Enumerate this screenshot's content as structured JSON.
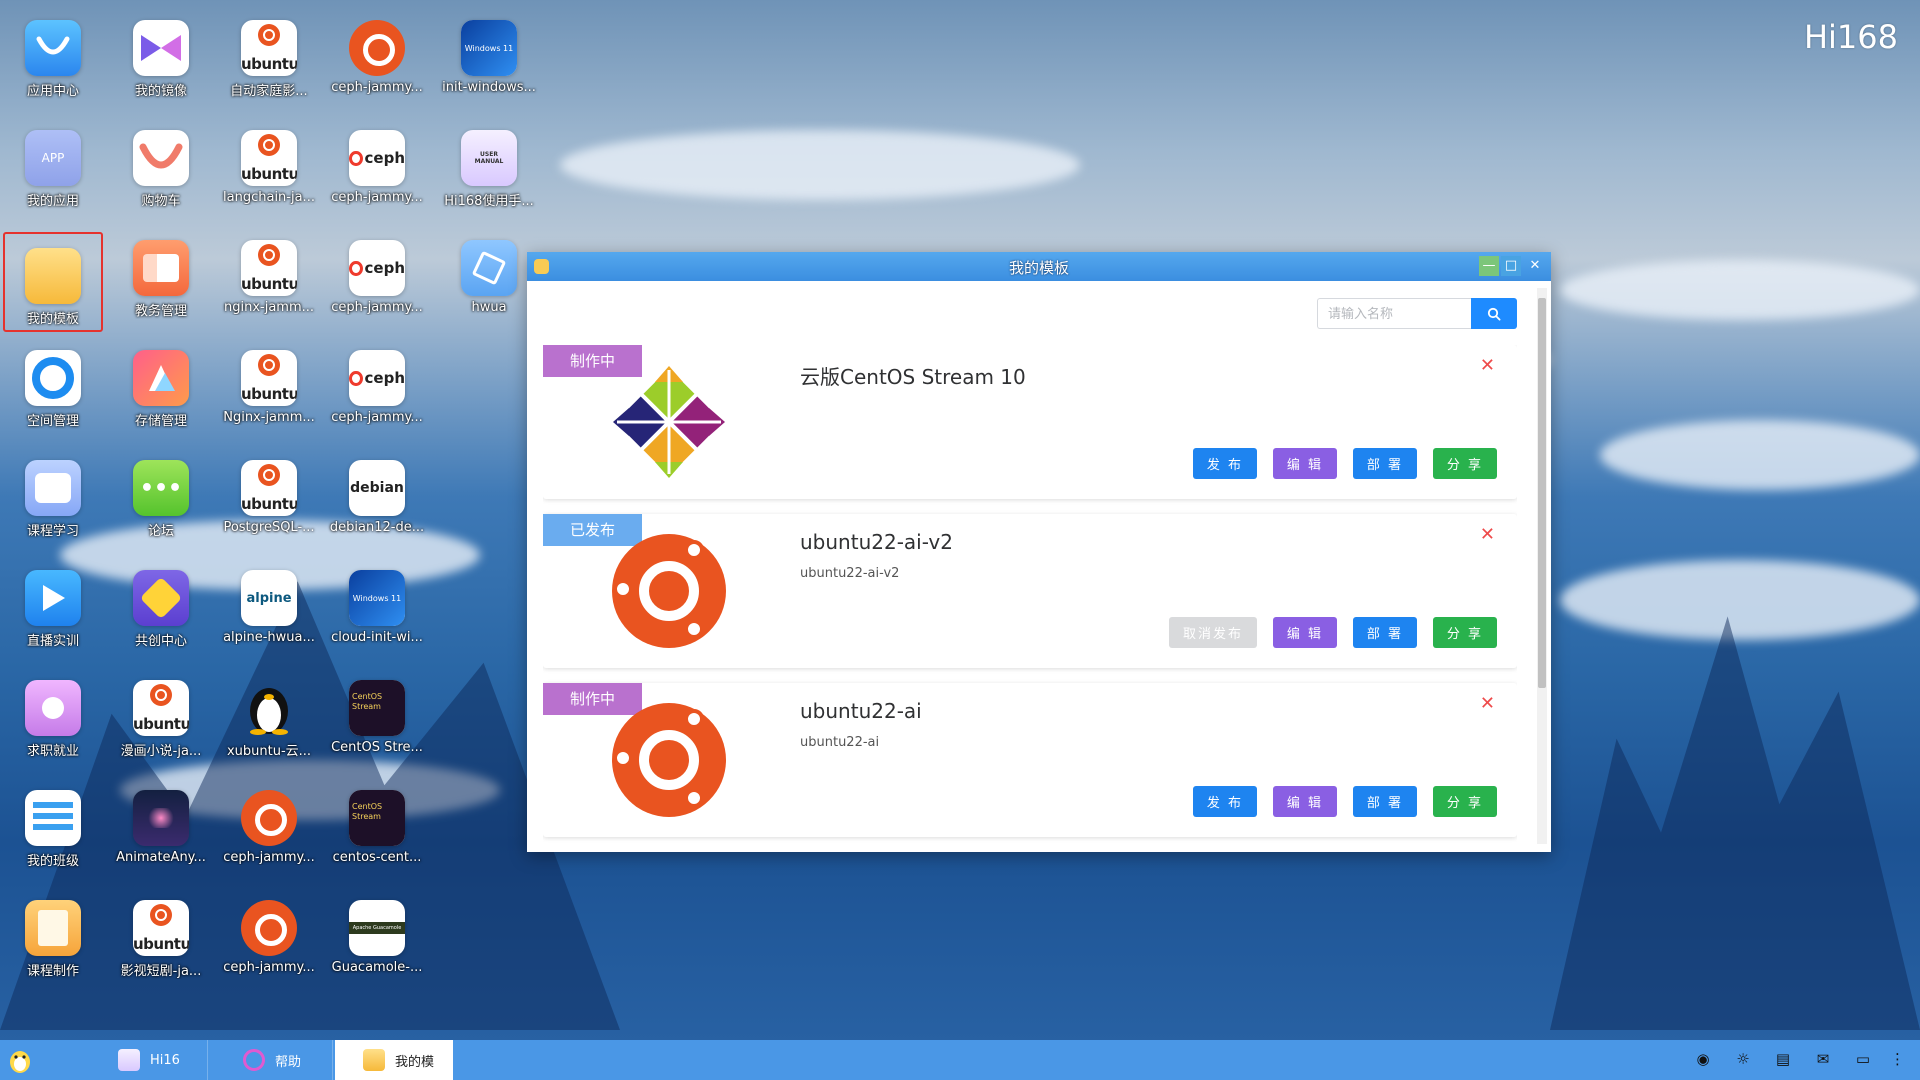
{
  "brand": {
    "logo_text": "Hi168"
  },
  "desktop_icons": [
    {
      "label": "应用中心",
      "icon": "app-center-icon"
    },
    {
      "label": "我的应用",
      "icon": "my-apps-icon",
      "badge": "APP"
    },
    {
      "label": "我的模板",
      "icon": "my-templates-icon"
    },
    {
      "label": "空间管理",
      "icon": "space-management-icon"
    },
    {
      "label": "课程学习",
      "icon": "course-learning-icon"
    },
    {
      "label": "直播实训",
      "icon": "live-training-icon"
    },
    {
      "label": "求职就业",
      "icon": "job-icon"
    },
    {
      "label": "我的班级",
      "icon": "my-class-icon"
    },
    {
      "label": "课程制作",
      "icon": "course-making-icon"
    },
    {
      "label": "我的镜像",
      "icon": "my-images-icon"
    },
    {
      "label": "购物车",
      "icon": "shopping-cart-icon"
    },
    {
      "label": "教务管理",
      "icon": "academic-management-icon"
    },
    {
      "label": "存储管理",
      "icon": "storage-management-icon"
    },
    {
      "label": "论坛",
      "icon": "forum-icon"
    },
    {
      "label": "共创中心",
      "icon": "co-creation-icon"
    },
    {
      "label": "漫画小说-ja...",
      "icon": "ubuntu-icon",
      "word": "ubuntu"
    },
    {
      "label": "AnimateAny...",
      "icon": "animate-icon"
    },
    {
      "label": "影视短剧-ja...",
      "icon": "ubuntu-icon",
      "word": "ubuntu"
    },
    {
      "label": "自动家庭影...",
      "icon": "ubuntu-icon",
      "word": "ubuntu"
    },
    {
      "label": "langchain-ja...",
      "icon": "ubuntu-icon",
      "word": "ubuntu"
    },
    {
      "label": "nginx-jamm...",
      "icon": "ubuntu-icon",
      "word": "ubuntu"
    },
    {
      "label": "Nginx-jamm...",
      "icon": "ubuntu-icon",
      "word": "ubuntu"
    },
    {
      "label": "PostgreSQL-...",
      "icon": "ubuntu-icon",
      "word": "ubuntu"
    },
    {
      "label": "alpine-hwua...",
      "icon": "alpine-icon",
      "word": "alpine"
    },
    {
      "label": "xubuntu-云...",
      "icon": "penguin-icon"
    },
    {
      "label": "ceph-jammy...",
      "icon": "ubuntu-circle-icon"
    },
    {
      "label": "ceph-jammy...",
      "icon": "ubuntu-circle-icon"
    },
    {
      "label": "ceph-jammy...",
      "icon": "ubuntu-circle-icon"
    },
    {
      "label": "ceph-jammy...",
      "icon": "ceph-icon",
      "word": "ceph"
    },
    {
      "label": "ceph-jammy...",
      "icon": "ceph-icon",
      "word": "ceph"
    },
    {
      "label": "ceph-jammy...",
      "icon": "ceph-icon",
      "word": "ceph"
    },
    {
      "label": "debian12-de...",
      "icon": "debian-icon",
      "word": "debian"
    },
    {
      "label": "cloud-init-wi...",
      "icon": "windows-icon",
      "word": "Windows 11"
    },
    {
      "label": "CentOS Stre...",
      "icon": "centos-stream-icon",
      "word": "CentOS Stream"
    },
    {
      "label": "centos-cent...",
      "icon": "centos-stream-icon",
      "word": "CentOS Stream"
    },
    {
      "label": "Guacamole-...",
      "icon": "guacamole-icon",
      "word": "Apache Guacamole"
    },
    {
      "label": "init-windows...",
      "icon": "windows-icon",
      "word": "Windows 11"
    },
    {
      "label": "Hi168使用手...",
      "icon": "user-manual-icon",
      "word": "USER MANUAL"
    },
    {
      "label": "hwua",
      "icon": "hwua-icon"
    }
  ],
  "window": {
    "title": "我的模板",
    "search_placeholder": "请输入名称",
    "templates": [
      {
        "status": "制作中",
        "title": "云版CentOS Stream 10",
        "desc": "",
        "logo": "centos",
        "actions": [
          "发 布",
          "编 辑",
          "部 署",
          "分 享"
        ]
      },
      {
        "status": "已发布",
        "title": "ubuntu22-ai-v2",
        "desc": "ubuntu22-ai-v2",
        "logo": "ubuntu",
        "actions": [
          "取消发布",
          "编 辑",
          "部 署",
          "分 享"
        ]
      },
      {
        "status": "制作中",
        "title": "ubuntu22-ai",
        "desc": "ubuntu22-ai",
        "logo": "ubuntu",
        "actions": [
          "发 布",
          "编 辑",
          "部 署",
          "分 享"
        ]
      }
    ]
  },
  "taskbar": {
    "items": [
      {
        "label": "Hi16"
      },
      {
        "label": "帮助"
      },
      {
        "label": "我的模"
      }
    ]
  },
  "colors": {
    "tag_making": "#b971ce",
    "tag_published": "#6aacef",
    "primary": "#1e84f0",
    "edit": "#8a5fe3",
    "share": "#29b24d",
    "ubuntu": "#e95420",
    "taskbar": "#4a97e6"
  }
}
